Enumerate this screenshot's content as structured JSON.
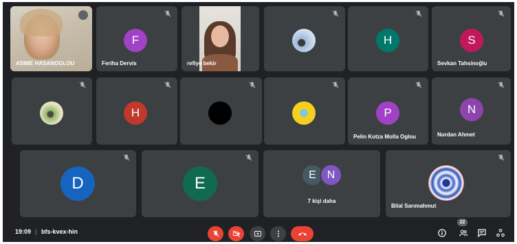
{
  "participants": {
    "asime": {
      "name": "ASIME HASANOGLOU"
    },
    "feriha": {
      "name": "Feriha Dervis",
      "initial": "F",
      "color": "#a142c6"
    },
    "refiye": {
      "name": "refiye bekir"
    },
    "photo_mountain": {
      "name": ""
    },
    "h1": {
      "name": "",
      "initial": "H",
      "color": "#00796b"
    },
    "sevkan": {
      "name": "Sevkan Tahsinoğlu",
      "initial": "S",
      "color": "#c2185b"
    },
    "photo_beach": {
      "name": ""
    },
    "h2": {
      "name": "",
      "initial": "H",
      "color": "#c0392b"
    },
    "black": {
      "name": ""
    },
    "cartoon": {
      "name": ""
    },
    "pelin": {
      "name": "Pelin Kotza Molla Oglou",
      "initial": "P",
      "color": "#a142c6"
    },
    "nurdan": {
      "name": "Nurdan Ahmet",
      "initial": "N",
      "color": "#8e44ad"
    },
    "d": {
      "name": "",
      "initial": "D",
      "color": "#1565c0"
    },
    "e": {
      "name": "",
      "initial": "E",
      "color": "#0f6b4f"
    },
    "more": {
      "label": "7 kişi daha",
      "initial_e": "E",
      "initial_n": "N",
      "color_e": "#455a64",
      "color_n": "#7e57c2"
    },
    "bilal": {
      "name": "Bilal Sarımahmut"
    }
  },
  "bottom_bar": {
    "time": "19:09",
    "separator": "|",
    "meeting_code": "bfs-kvex-hin",
    "people_count": "22"
  },
  "colors": {
    "background": "#202124",
    "tile": "#3c4043",
    "muted_red": "#ea4335",
    "control_gray": "#3c4043"
  },
  "icons": [
    "mic-off-icon",
    "camera-off-icon",
    "present-icon",
    "more-options-icon",
    "leave-call-icon",
    "info-icon",
    "people-icon",
    "chat-icon",
    "activities-icon"
  ]
}
